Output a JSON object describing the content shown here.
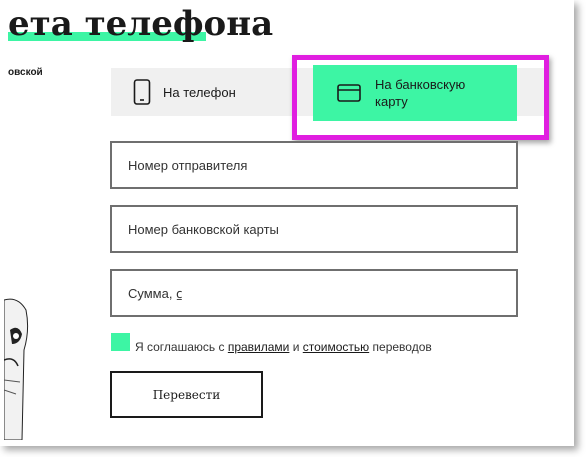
{
  "page": {
    "title": "ета телефона",
    "side_text": "овской"
  },
  "tabs": {
    "phone_label": "На телефон",
    "card_label": "На банковскую карту",
    "active": "card",
    "active_color": "#3df5a4"
  },
  "form": {
    "sender_placeholder": "Номер отправителя",
    "card_placeholder": "Номер банковской карты",
    "amount_placeholder": "Сумма, ⃀"
  },
  "agreement": {
    "text_before": "Я соглашаюсь с ",
    "rules_link": "правилами",
    "text_middle": " и ",
    "cost_link": "стоимостью",
    "text_after": " переводов",
    "checked_color": "#3df5a4"
  },
  "submit": {
    "label": "Перевести"
  },
  "annotation": {
    "highlight_color": "#e01ee0"
  }
}
